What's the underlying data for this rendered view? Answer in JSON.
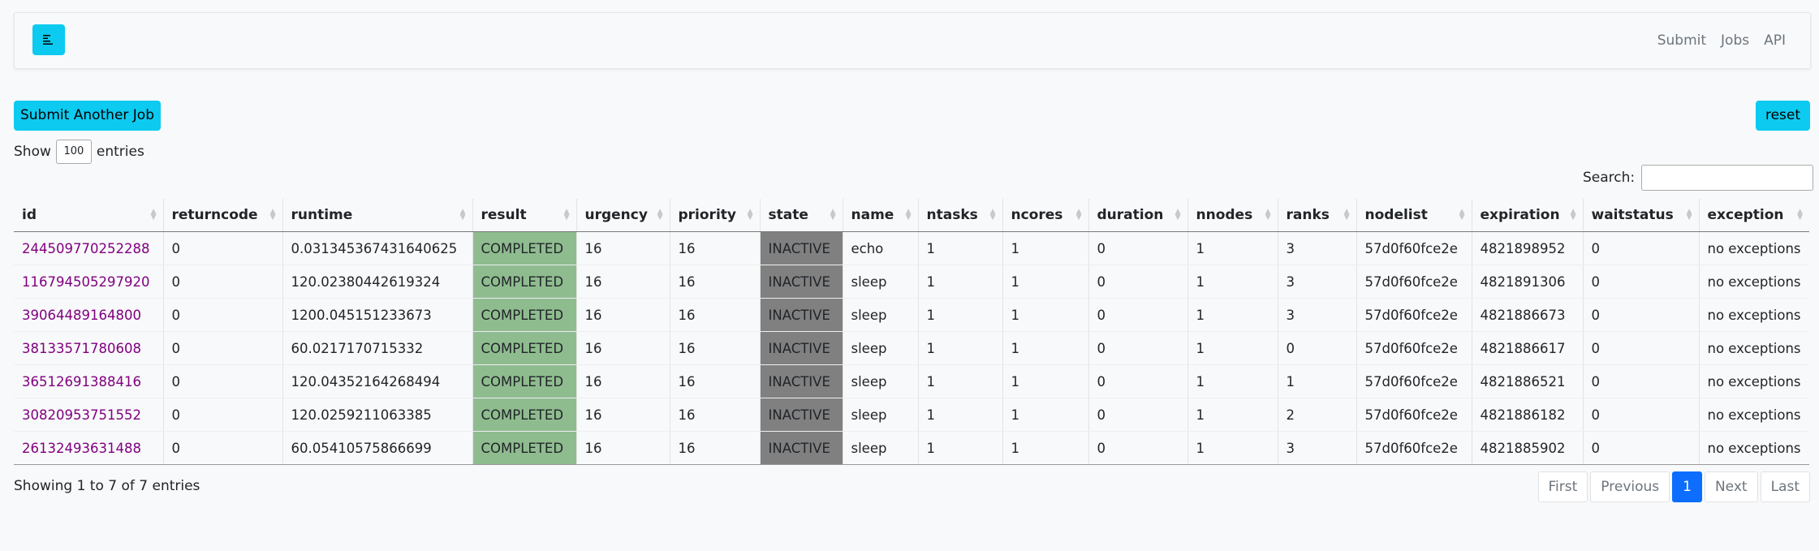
{
  "nav": {
    "links": [
      "Submit",
      "Jobs",
      "API"
    ]
  },
  "toolbar": {
    "submit_label": "Submit Another Job",
    "reset_label": "reset"
  },
  "length": {
    "prefix": "Show",
    "value": "100",
    "suffix": "entries"
  },
  "search": {
    "label": "Search:",
    "value": ""
  },
  "table": {
    "columns": [
      "id",
      "returncode",
      "runtime",
      "result",
      "urgency",
      "priority",
      "state",
      "name",
      "ntasks",
      "ncores",
      "duration",
      "nnodes",
      "ranks",
      "nodelist",
      "expiration",
      "waitstatus",
      "exception"
    ],
    "rows": [
      [
        "244509770252288",
        "0",
        "0.031345367431640625",
        "COMPLETED",
        "16",
        "16",
        "INACTIVE",
        "echo",
        "1",
        "1",
        "0",
        "1",
        "3",
        "57d0f60fce2e",
        "4821898952",
        "0",
        "no exceptions"
      ],
      [
        "116794505297920",
        "0",
        "120.02380442619324",
        "COMPLETED",
        "16",
        "16",
        "INACTIVE",
        "sleep",
        "1",
        "1",
        "0",
        "1",
        "3",
        "57d0f60fce2e",
        "4821891306",
        "0",
        "no exceptions"
      ],
      [
        "39064489164800",
        "0",
        "1200.045151233673",
        "COMPLETED",
        "16",
        "16",
        "INACTIVE",
        "sleep",
        "1",
        "1",
        "0",
        "1",
        "3",
        "57d0f60fce2e",
        "4821886673",
        "0",
        "no exceptions"
      ],
      [
        "38133571780608",
        "0",
        "60.0217170715332",
        "COMPLETED",
        "16",
        "16",
        "INACTIVE",
        "sleep",
        "1",
        "1",
        "0",
        "1",
        "0",
        "57d0f60fce2e",
        "4821886617",
        "0",
        "no exceptions"
      ],
      [
        "36512691388416",
        "0",
        "120.04352164268494",
        "COMPLETED",
        "16",
        "16",
        "INACTIVE",
        "sleep",
        "1",
        "1",
        "0",
        "1",
        "1",
        "57d0f60fce2e",
        "4821886521",
        "0",
        "no exceptions"
      ],
      [
        "30820953751552",
        "0",
        "120.0259211063385",
        "COMPLETED",
        "16",
        "16",
        "INACTIVE",
        "sleep",
        "1",
        "1",
        "0",
        "1",
        "2",
        "57d0f60fce2e",
        "4821886182",
        "0",
        "no exceptions"
      ],
      [
        "26132493631488",
        "0",
        "60.05410575866699",
        "COMPLETED",
        "16",
        "16",
        "INACTIVE",
        "sleep",
        "1",
        "1",
        "0",
        "1",
        "3",
        "57d0f60fce2e",
        "4821885902",
        "0",
        "no exceptions"
      ]
    ]
  },
  "footer": {
    "info": "Showing 1 to 7 of 7 entries",
    "pagination": [
      "First",
      "Previous",
      "1",
      "Next",
      "Last"
    ],
    "active_page": "1"
  },
  "colors": {
    "accent": "#0dcaf0",
    "completed": "#8fbc8f",
    "inactive": "#808080",
    "link": "#800080",
    "page_active": "#0d6efd"
  }
}
